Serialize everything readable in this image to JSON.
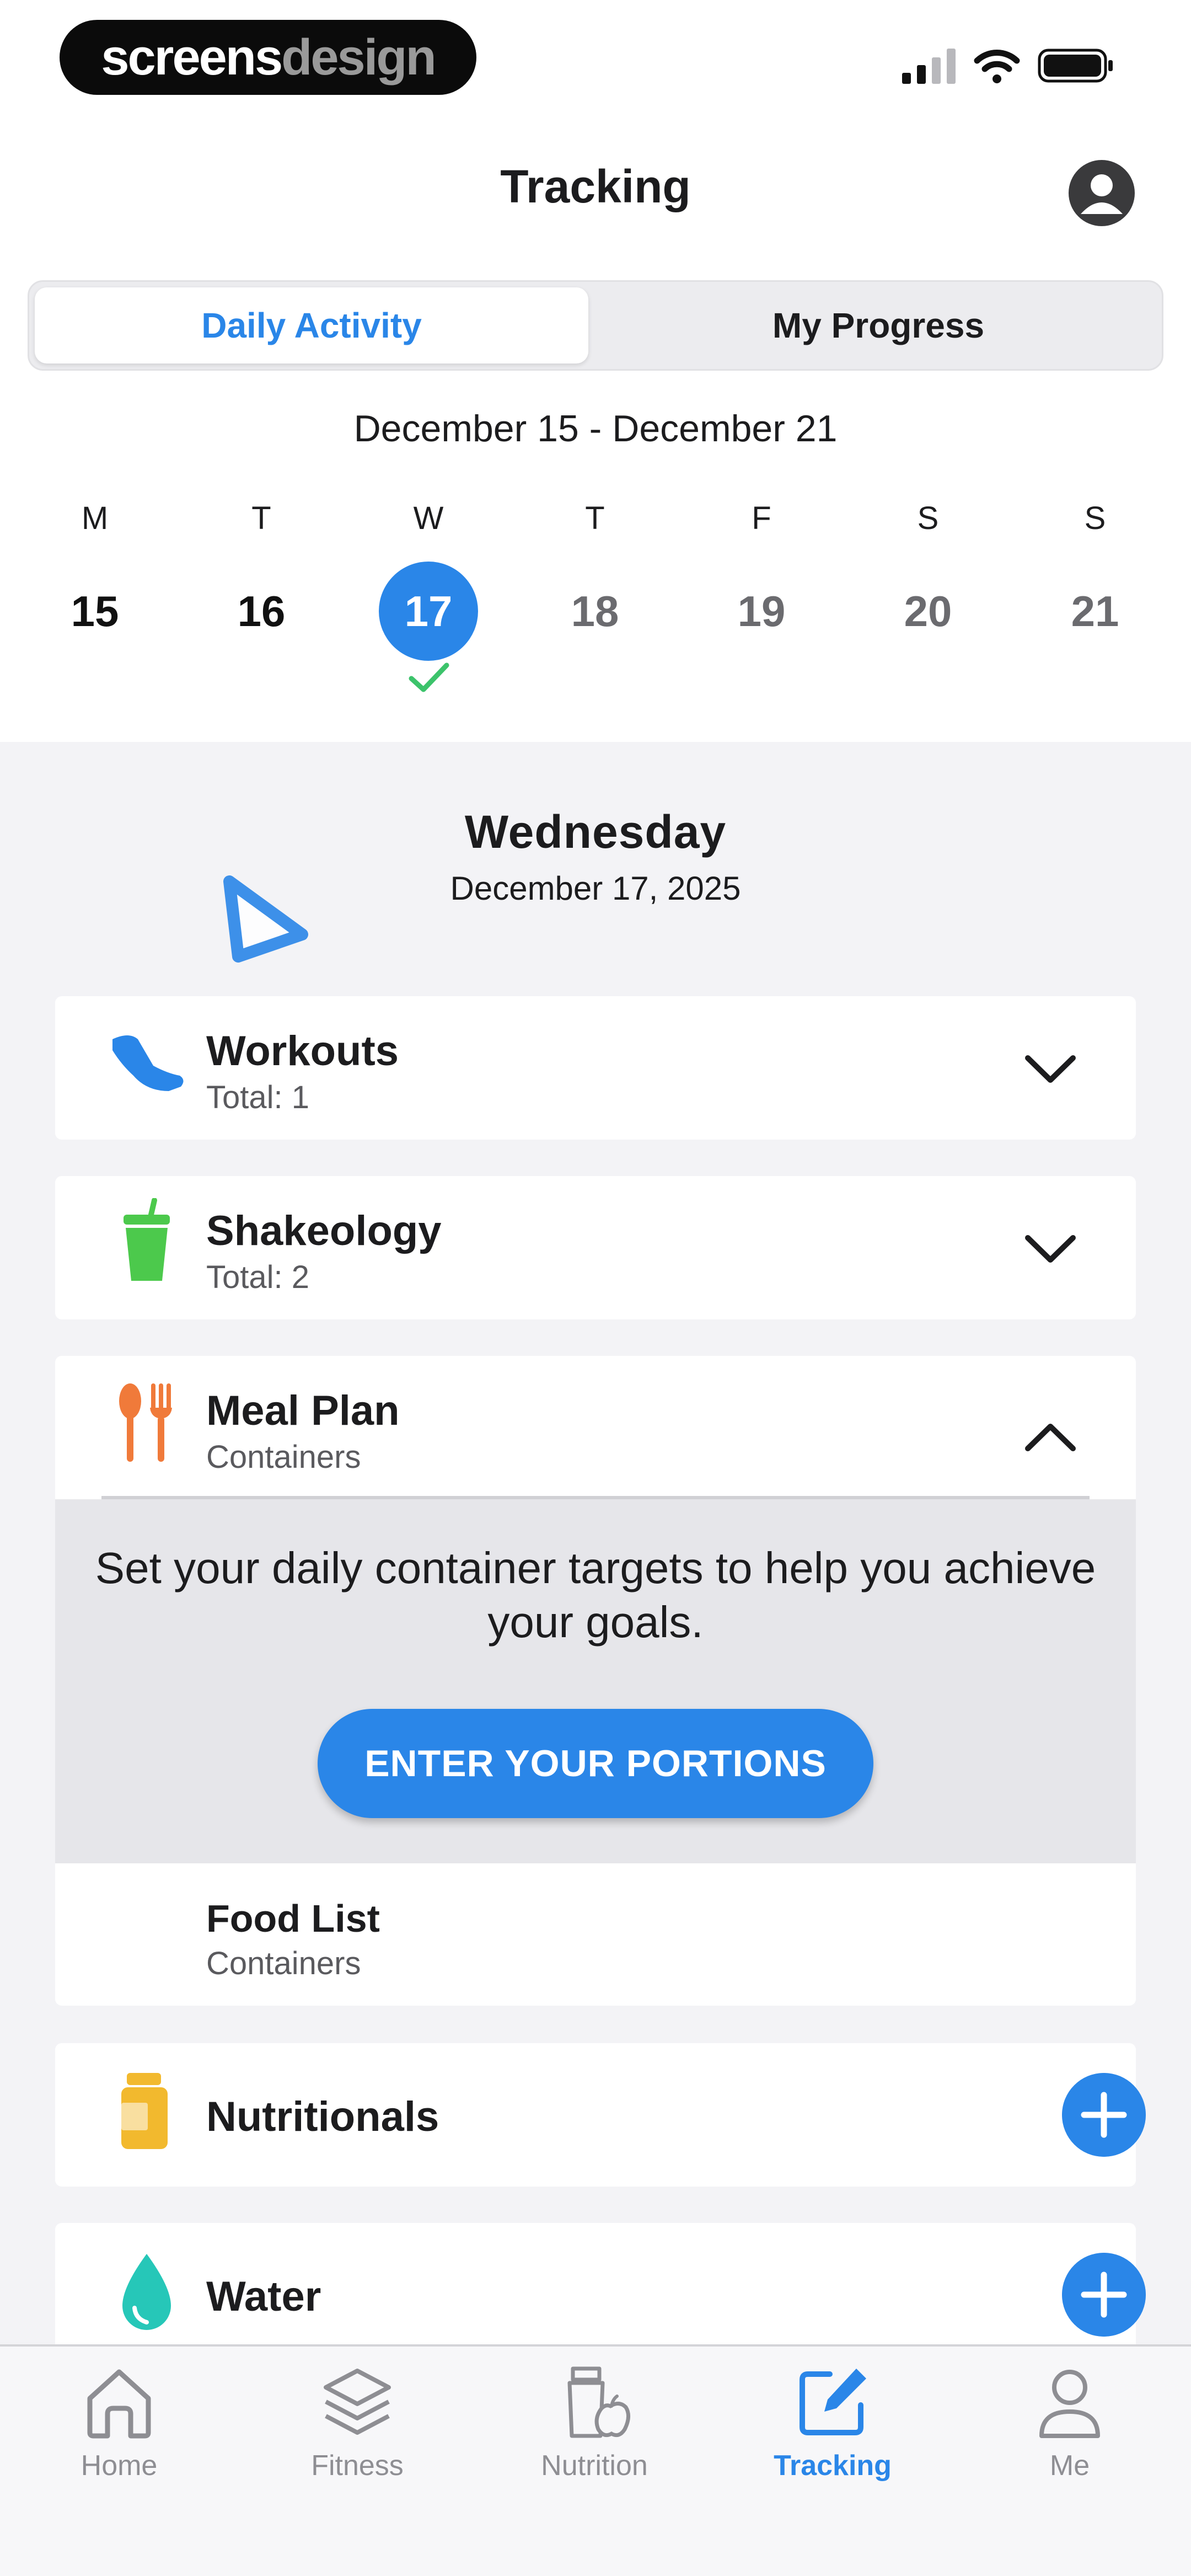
{
  "status_bar": {
    "brand_part1": "screens",
    "brand_part2": "design",
    "icons": [
      "cellular-signal-icon",
      "wifi-icon",
      "battery-icon"
    ]
  },
  "header": {
    "title": "Tracking",
    "profile_icon": "person-circle-icon"
  },
  "segments": {
    "active": "Daily Activity",
    "inactive": "My Progress"
  },
  "week": {
    "range": "December 15 - December 21",
    "days": [
      {
        "letter": "M",
        "num": "15",
        "state": "past"
      },
      {
        "letter": "T",
        "num": "16",
        "state": "past"
      },
      {
        "letter": "W",
        "num": "17",
        "state": "selected"
      },
      {
        "letter": "T",
        "num": "18",
        "state": "future"
      },
      {
        "letter": "F",
        "num": "19",
        "state": "future"
      },
      {
        "letter": "S",
        "num": "20",
        "state": "future"
      },
      {
        "letter": "S",
        "num": "21",
        "state": "future"
      }
    ]
  },
  "selected_day": {
    "weekday": "Wednesday",
    "date": "December 17, 2025"
  },
  "cards": {
    "workouts": {
      "title": "Workouts",
      "subtitle": "Total: 1",
      "icon": "sneaker-icon"
    },
    "shakeology": {
      "title": "Shakeology",
      "subtitle": "Total: 2",
      "icon": "shake-cup-icon"
    },
    "meal_plan": {
      "title": "Meal Plan",
      "subtitle": "Containers",
      "icon": "utensils-icon"
    },
    "food_list": {
      "title": "Food List",
      "subtitle": "Containers"
    },
    "nutritionals": {
      "title": "Nutritionals",
      "icon": "supplement-bottle-icon"
    },
    "water": {
      "title": "Water",
      "icon": "water-drop-icon"
    }
  },
  "meal_panel": {
    "message": "Set your daily container targets to help you achieve your goals.",
    "button_label": "ENTER YOUR PORTIONS"
  },
  "tabbar": {
    "items": [
      {
        "label": "Home",
        "icon": "home-icon"
      },
      {
        "label": "Fitness",
        "icon": "layers-icon"
      },
      {
        "label": "Nutrition",
        "icon": "nutrition-icon"
      },
      {
        "label": "Tracking",
        "icon": "edit-square-icon"
      },
      {
        "label": "Me",
        "icon": "person-icon"
      }
    ],
    "active": "Tracking"
  },
  "colors": {
    "accent": "#2a86e8",
    "check_green": "#3cc36b",
    "workouts_icon": "#2a86e8",
    "shakeology_icon": "#4cc94c",
    "meal_icon": "#f07a3a",
    "nutritionals_icon": "#f2b92e",
    "water_icon": "#26c7b8"
  }
}
